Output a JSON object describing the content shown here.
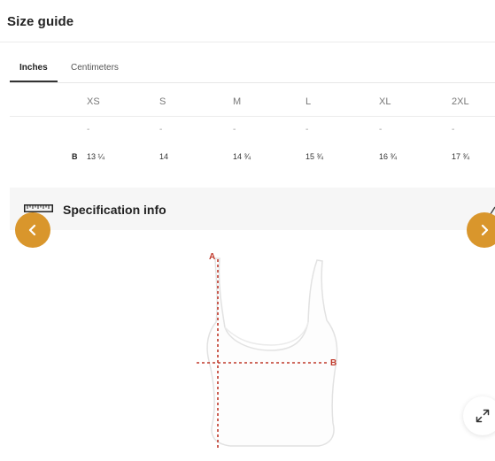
{
  "header": {
    "title": "Size guide"
  },
  "tabs": [
    {
      "label": "Inches",
      "active": true
    },
    {
      "label": "Centimeters",
      "active": false
    }
  ],
  "table": {
    "sizes": [
      "XS",
      "S",
      "M",
      "L",
      "XL",
      "2XL"
    ],
    "empty_row": [
      "-",
      "-",
      "-",
      "-",
      "-",
      "-"
    ],
    "rows": [
      {
        "label": "B",
        "values": [
          "13 ¼",
          "14",
          "14 ¾",
          "15 ¾",
          "16 ¾",
          "17 ¾"
        ]
      }
    ]
  },
  "spec": {
    "title": "Specification info"
  },
  "diagram": {
    "marker_a": "A",
    "marker_b": "B"
  },
  "colors": {
    "accent": "#d9962c",
    "measure_line": "#c0392b"
  }
}
